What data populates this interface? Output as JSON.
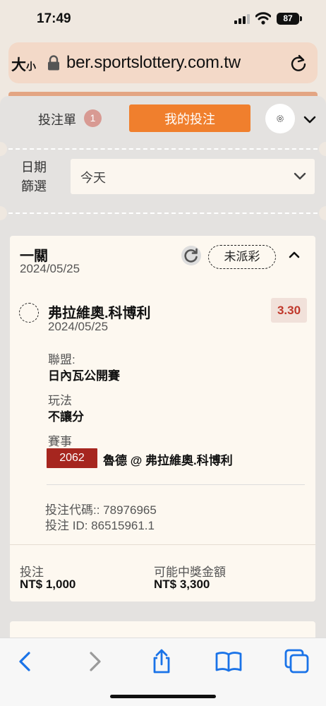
{
  "status_bar": {
    "time": "17:49",
    "battery": "87"
  },
  "browser": {
    "text_size_large": "大",
    "text_size_small": "小",
    "url": "ber.sportslottery.com.tw"
  },
  "header": {
    "slip_tab_label": "投注單",
    "slip_count": "1",
    "my_bets_label": "我的投注"
  },
  "filter": {
    "label_line1": "日期",
    "label_line2": "篩選",
    "selected": "今天"
  },
  "bet": {
    "type": "一關",
    "date": "2024/05/25",
    "status": "未派彩",
    "selection": {
      "name": "弗拉維奧.科博利",
      "date": "2024/05/25",
      "odds": "3.30",
      "league_label": "聯盟:",
      "league": "日內瓦公開賽",
      "market_label": "玩法",
      "market": "不讓分",
      "event_label": "賽事",
      "event_code": "2062",
      "event_name": "魯德 @ 弗拉維奧.科博利"
    },
    "bet_code": "投注代碼:: 78976965",
    "bet_id": "投注 ID: 86515961.1",
    "stake_label": "投注",
    "stake": "NT$ 1,000",
    "payout_label": "可能中獎金額",
    "payout": "NT$ 3,300"
  },
  "colors": {
    "primary": "#f07f2d",
    "odds_text": "#c0372a",
    "event_badge": "#a6261f",
    "toolbar_icons": "#1a73e8"
  },
  "icons": [
    "signal-icon",
    "wifi-icon",
    "lock-icon",
    "reload-icon",
    "gear-icon",
    "chevron-down-icon",
    "refresh-icon",
    "chevron-up-icon",
    "back-icon",
    "forward-icon",
    "share-icon",
    "bookmarks-icon",
    "tabs-icon"
  ]
}
